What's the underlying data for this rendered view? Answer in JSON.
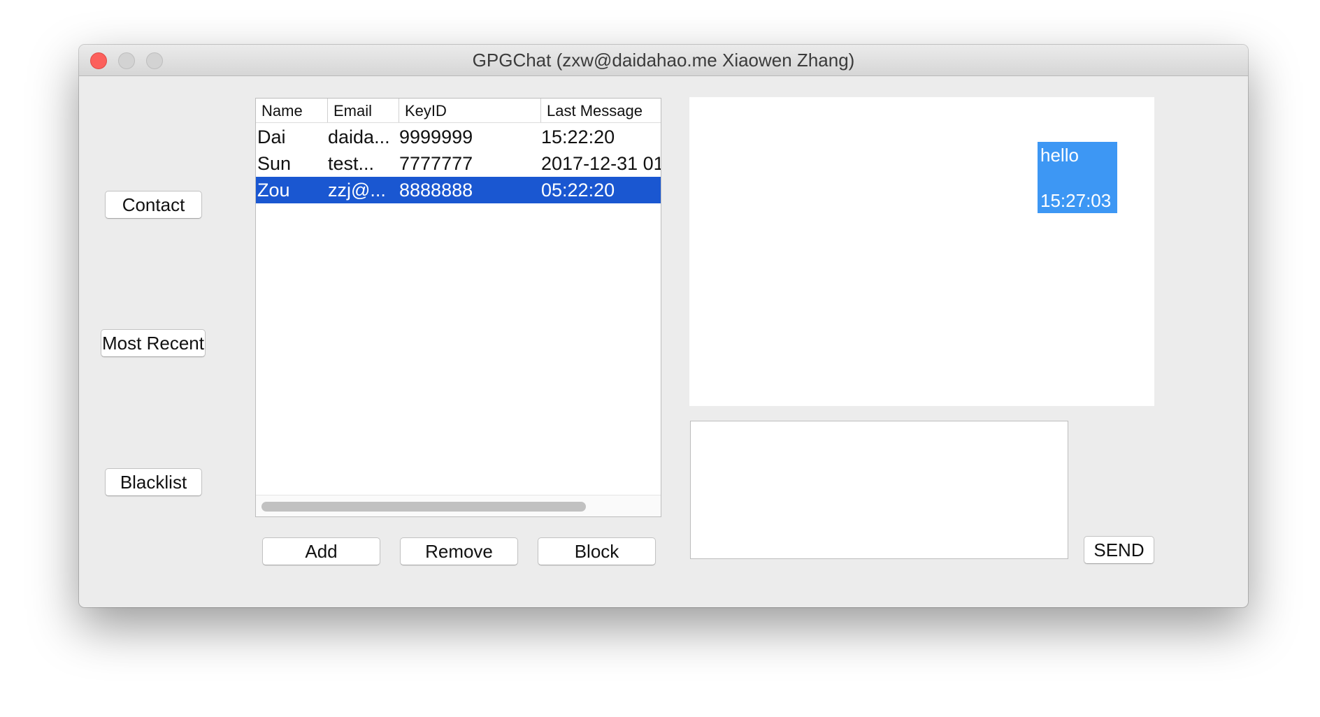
{
  "window": {
    "title": "GPGChat (zxw@daidahao.me Xiaowen Zhang)"
  },
  "sidebar": {
    "contact_label": "Contact",
    "most_recent_label": "Most Recent",
    "blacklist_label": "Blacklist"
  },
  "contacts_table": {
    "columns": [
      "Name",
      "Email",
      "KeyID",
      "Last Message"
    ],
    "rows": [
      {
        "name": "Dai",
        "email": "daida...",
        "keyid": "9999999",
        "last_message": "15:22:20",
        "selected": false
      },
      {
        "name": "Sun",
        "email": "test...",
        "keyid": "7777777",
        "last_message": "2017-12-31 01",
        "selected": false
      },
      {
        "name": "Zou",
        "email": "zzj@...",
        "keyid": "8888888",
        "last_message": "05:22:20",
        "selected": true
      }
    ]
  },
  "actions": {
    "add_label": "Add",
    "remove_label": "Remove",
    "block_label": "Block"
  },
  "chat": {
    "messages": [
      {
        "text": "hello",
        "time": "15:27:03"
      }
    ],
    "input_value": "",
    "send_label": "SEND"
  },
  "colors": {
    "selection": "#1a57d1",
    "bubble": "#3d97f4",
    "close_button": "#fc605c"
  }
}
